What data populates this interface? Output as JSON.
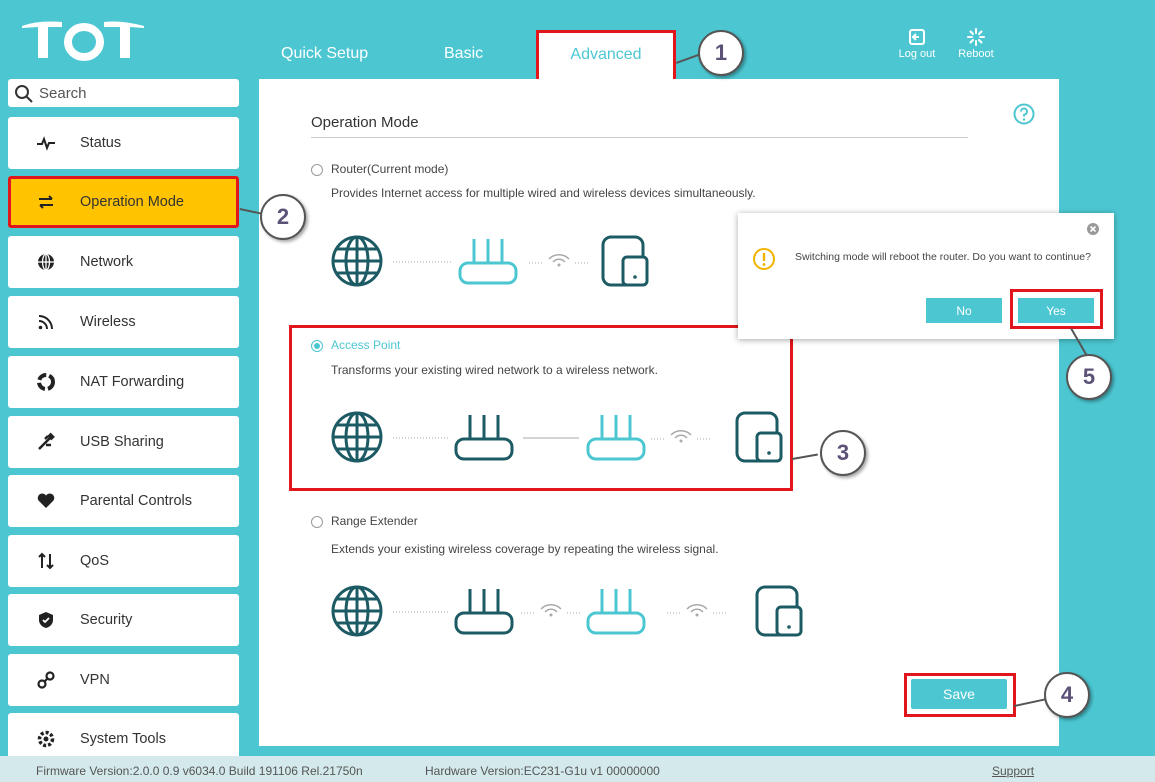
{
  "brand": {
    "accent": "#4cc7d2",
    "highlight": "#ffc300",
    "callout_border": "#e0161c"
  },
  "header": {
    "tabs": [
      {
        "label": "Quick Setup"
      },
      {
        "label": "Basic"
      },
      {
        "label": "Advanced",
        "selected": true
      }
    ],
    "logout_label": "Log out",
    "reboot_label": "Reboot"
  },
  "sidebar": {
    "search_placeholder": "Search",
    "items": [
      {
        "label": "Status",
        "icon": "pulse-icon"
      },
      {
        "label": "Operation Mode",
        "icon": "swap-arrows-icon",
        "active": true
      },
      {
        "label": "Network",
        "icon": "globe-icon"
      },
      {
        "label": "Wireless",
        "icon": "wifi-icon"
      },
      {
        "label": "NAT Forwarding",
        "icon": "nat-icon"
      },
      {
        "label": "USB Sharing",
        "icon": "usb-icon"
      },
      {
        "label": "Parental Controls",
        "icon": "heart-icon"
      },
      {
        "label": "QoS",
        "icon": "updown-arrows-icon"
      },
      {
        "label": "Security",
        "icon": "shield-icon"
      },
      {
        "label": "VPN",
        "icon": "link-icon"
      },
      {
        "label": "System Tools",
        "icon": "gear-icon"
      }
    ]
  },
  "main": {
    "title": "Operation Mode",
    "options": [
      {
        "label": "Router(Current mode)",
        "description": "Provides Internet access for multiple wired and wireless devices simultaneously.",
        "selected": false
      },
      {
        "label": "Access Point",
        "description": "Transforms your existing wired network to a wireless network.",
        "selected": true
      },
      {
        "label": "Range Extender",
        "description": "Extends your existing wireless coverage by repeating the wireless signal.",
        "selected": false
      }
    ],
    "save_label": "Save"
  },
  "dialog": {
    "message": "Switching mode will reboot the router. Do you want to continue?",
    "no_label": "No",
    "yes_label": "Yes"
  },
  "callouts": [
    "1",
    "2",
    "3",
    "4",
    "5"
  ],
  "footer": {
    "firmware": "Firmware Version:2.0.0 0.9 v6034.0 Build 191106 Rel.21750n",
    "hardware": "Hardware Version:EC231-G1u v1 00000000",
    "support": "Support"
  }
}
